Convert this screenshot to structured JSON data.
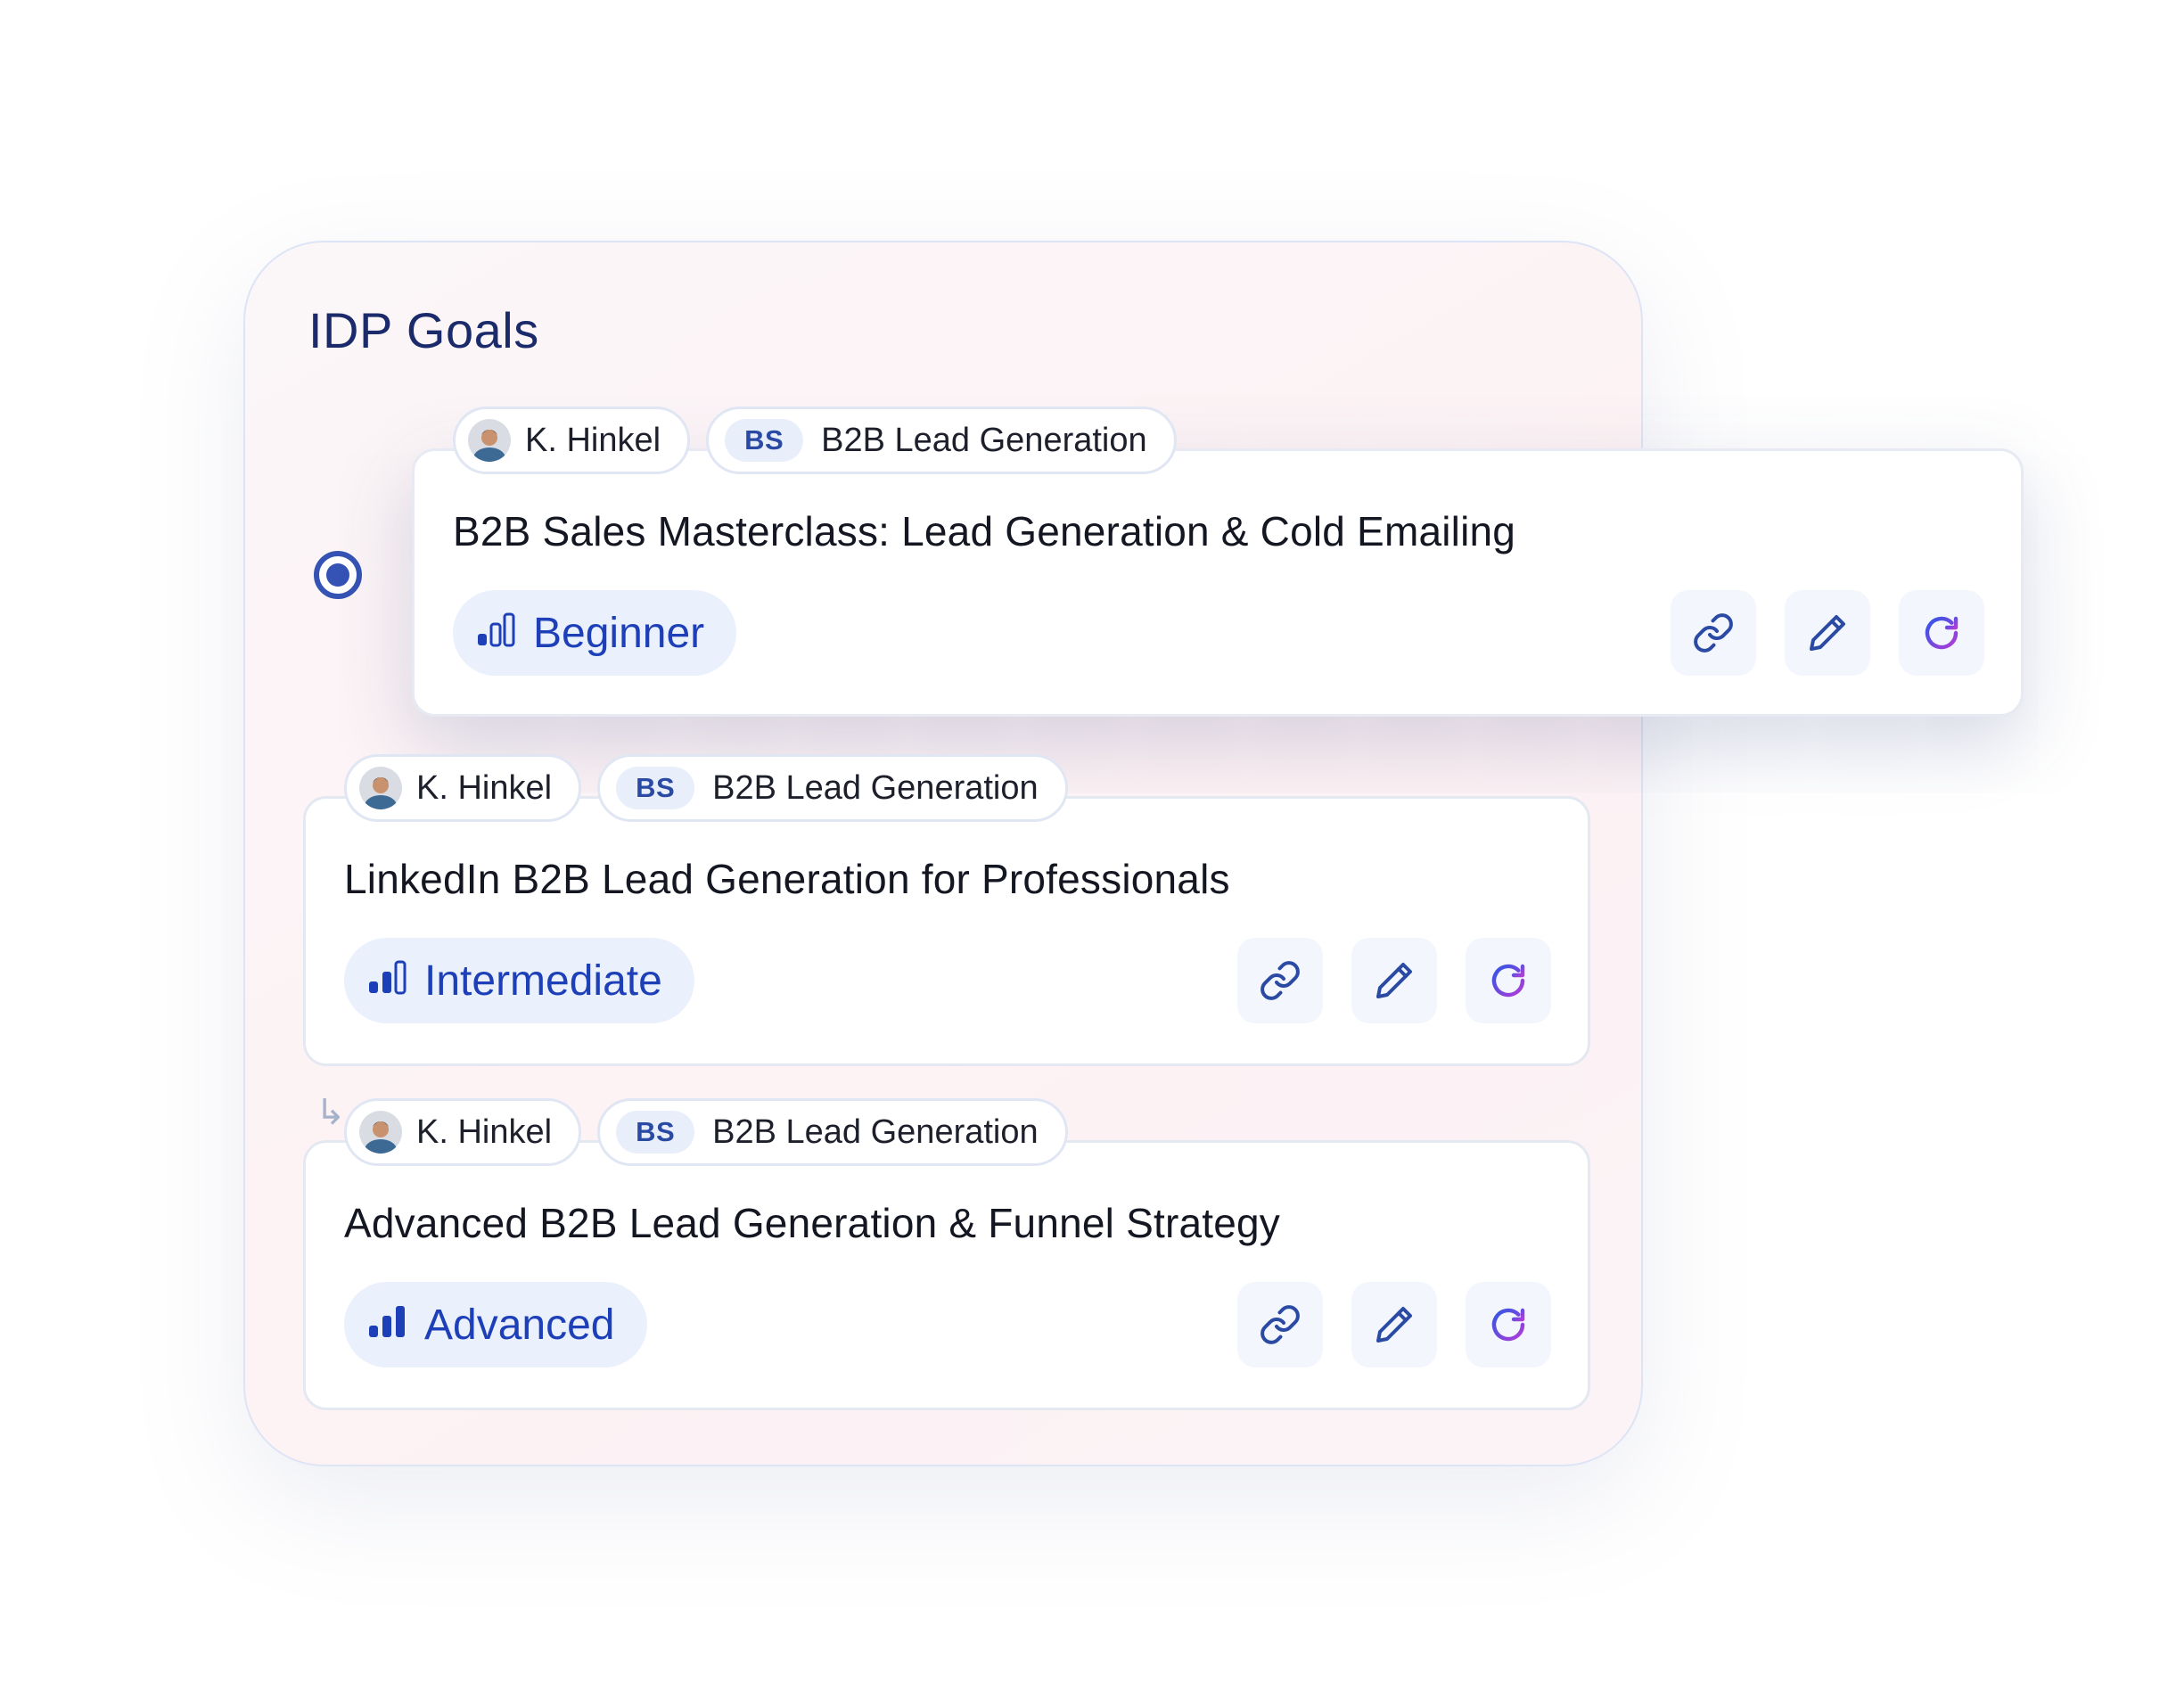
{
  "panel": {
    "title": "IDP Goals"
  },
  "goals": [
    {
      "owner": "K. Hinkel",
      "tag_abbr": "BS",
      "tag_label": "B2B Lead Generation",
      "title": "B2B Sales Masterclass: Lead Generation & Cold Emailing",
      "level": "Beginner",
      "level_bars_filled": 1
    },
    {
      "owner": "K. Hinkel",
      "tag_abbr": "BS",
      "tag_label": "B2B Lead Generation",
      "title": "LinkedIn B2B Lead Generation for Professionals",
      "level": "Intermediate",
      "level_bars_filled": 2
    },
    {
      "owner": "K. Hinkel",
      "tag_abbr": "BS",
      "tag_label": "B2B Lead Generation",
      "title": "Advanced B2B Lead Generation & Funnel Strategy",
      "level": "Advanced",
      "level_bars_filled": 3
    }
  ],
  "icons": {
    "link": "link-icon",
    "edit": "pencil-icon",
    "refresh": "refresh-icon",
    "level": "signal-bars-icon",
    "radio": "radio-selected",
    "connector": "sub-arrow-icon"
  },
  "colors": {
    "accent": "#3553b4",
    "level_text": "#1d3fb8",
    "level_bg": "#eaf0fc",
    "tag_bg": "#e9eefb",
    "title": "#1b2a6b",
    "refresh_gradient_start": "#2f56e6",
    "refresh_gradient_end": "#b13cd8"
  }
}
